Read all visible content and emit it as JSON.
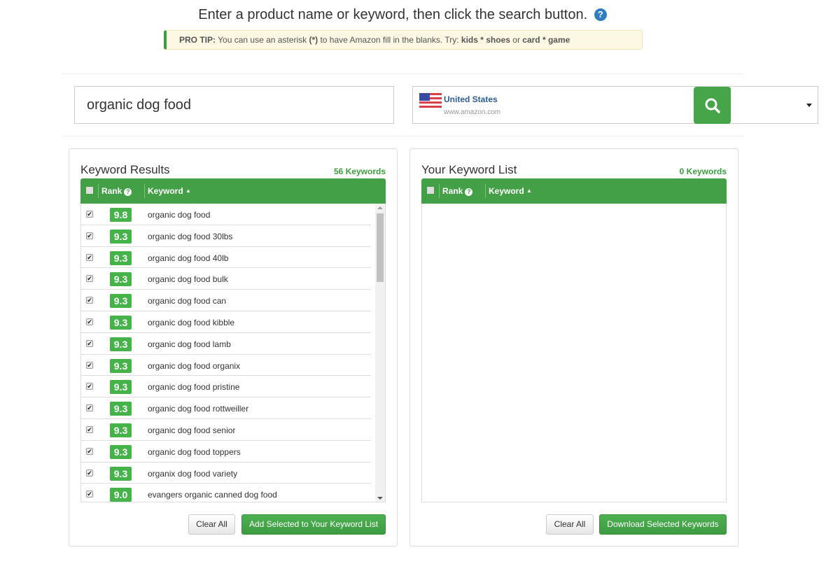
{
  "header": {
    "headline": "Enter a product name or keyword, then click the search button.",
    "help_icon": "question-circle-icon",
    "tip": {
      "label": "PRO TIP:",
      "text1": " You can use an asterisk ",
      "asterisk": "(*)",
      "text2": " to have Amazon fill in the blanks. Try: ",
      "ex1": "kids * shoes",
      "or": " or ",
      "ex2": "card * game"
    }
  },
  "search": {
    "value": "organic dog food"
  },
  "country": {
    "name": "United States",
    "url": "www.amazon.com",
    "search_icon": "search-icon"
  },
  "colors": {
    "accent": "#43a047",
    "rank_badge": "#46b34a",
    "tip_bg": "#fcf8e3",
    "link": "#2c5d8f"
  },
  "results": {
    "title": "Keyword Results",
    "count": "56 Keywords",
    "col_rank": "Rank",
    "col_keyword": "Keyword",
    "rows": [
      {
        "rank": "9.8",
        "keyword": "organic dog food",
        "checked": true
      },
      {
        "rank": "9.3",
        "keyword": "organic dog food 30lbs",
        "checked": true
      },
      {
        "rank": "9.3",
        "keyword": "organic dog food 40lb",
        "checked": true
      },
      {
        "rank": "9.3",
        "keyword": "organic dog food bulk",
        "checked": true
      },
      {
        "rank": "9.3",
        "keyword": "organic dog food can",
        "checked": true
      },
      {
        "rank": "9.3",
        "keyword": "organic dog food kibble",
        "checked": true
      },
      {
        "rank": "9.3",
        "keyword": "organic dog food lamb",
        "checked": true
      },
      {
        "rank": "9.3",
        "keyword": "organic dog food organix",
        "checked": true
      },
      {
        "rank": "9.3",
        "keyword": "organic dog food pristine",
        "checked": true
      },
      {
        "rank": "9.3",
        "keyword": "organic dog food rottweiller",
        "checked": true
      },
      {
        "rank": "9.3",
        "keyword": "organic dog food senior",
        "checked": true
      },
      {
        "rank": "9.3",
        "keyword": "organic dog food toppers",
        "checked": true
      },
      {
        "rank": "9.3",
        "keyword": "organix dog food variety",
        "checked": true
      },
      {
        "rank": "9.0",
        "keyword": "evangers organic canned dog food",
        "checked": true
      }
    ],
    "clear_label": "Clear All",
    "add_label": "Add Selected to Your Keyword List"
  },
  "list": {
    "title": "Your Keyword List",
    "count": "0 Keywords",
    "col_rank": "Rank",
    "col_keyword": "Keyword",
    "clear_label": "Clear All",
    "download_label": "Download Selected Keywords"
  }
}
